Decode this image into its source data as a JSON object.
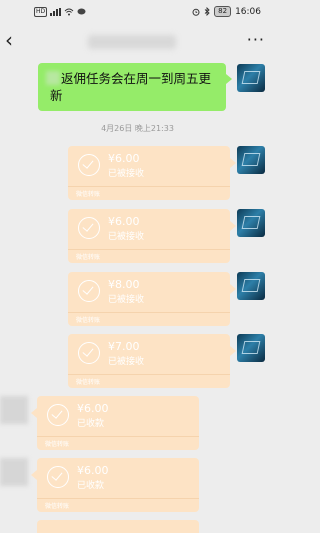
{
  "status_bar": {
    "network": "HD",
    "battery": "82",
    "time": "16:06"
  },
  "nav": {
    "back_glyph": "‹",
    "more_glyph": "···"
  },
  "text_message": "返佣任务会在周一到周五更新",
  "timestamp": "4月26日 晚上21:33",
  "transfers": [
    {
      "amount": "¥6.00",
      "status": "已被接收",
      "footer": "微信转账"
    },
    {
      "amount": "¥6.00",
      "status": "已被接收",
      "footer": "微信转账"
    },
    {
      "amount": "¥8.00",
      "status": "已被接收",
      "footer": "微信转账"
    },
    {
      "amount": "¥7.00",
      "status": "已被接收",
      "footer": "微信转账"
    },
    {
      "amount": "¥6.00",
      "status": "已收款",
      "footer": "微信转账"
    },
    {
      "amount": "¥6.00",
      "status": "已收款",
      "footer": "微信转账"
    }
  ],
  "colors": {
    "background": "#ededed",
    "sent_bubble": "#95ec69",
    "transfer_card": "#fde3c5"
  }
}
